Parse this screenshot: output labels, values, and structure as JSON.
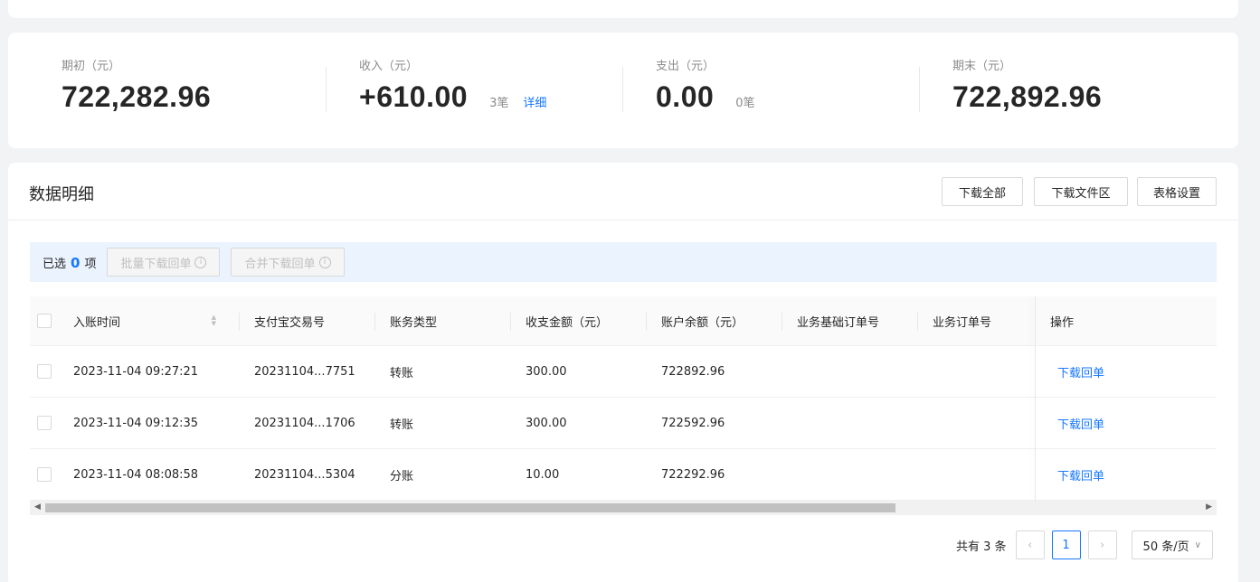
{
  "summary": {
    "opening": {
      "label": "期初（元）",
      "value": "722,282.96"
    },
    "income": {
      "label": "收入（元）",
      "value": "+610.00",
      "count": "3笔",
      "detail": "详细"
    },
    "expense": {
      "label": "支出（元）",
      "value": "0.00",
      "count": "0笔"
    },
    "closing": {
      "label": "期末（元）",
      "value": "722,892.96"
    }
  },
  "panel": {
    "title": "数据明细",
    "buttons": {
      "download_all": "下载全部",
      "download_files": "下载文件区",
      "table_settings": "表格设置"
    }
  },
  "selection": {
    "prefix": "已选",
    "count": "0",
    "suffix": "项",
    "batch_download": "批量下载回单",
    "merge_download": "合并下载回单"
  },
  "table": {
    "columns": {
      "time": "入账时间",
      "trade_no": "支付宝交易号",
      "type": "账务类型",
      "amount": "收支金额（元）",
      "balance": "账户余额（元）",
      "base_order": "业务基础订单号",
      "order": "业务订单号",
      "action": "操作"
    },
    "rows": [
      {
        "time": "2023-11-04 09:27:21",
        "trade_no": "20231104...7751",
        "type": "转账",
        "amount": "300.00",
        "balance": "722892.96",
        "base_order": "",
        "order": "",
        "action": "下载回单"
      },
      {
        "time": "2023-11-04 09:12:35",
        "trade_no": "20231104...1706",
        "type": "转账",
        "amount": "300.00",
        "balance": "722592.96",
        "base_order": "",
        "order": "",
        "action": "下载回单"
      },
      {
        "time": "2023-11-04 08:08:58",
        "trade_no": "20231104...5304",
        "type": "分账",
        "amount": "10.00",
        "balance": "722292.96",
        "base_order": "",
        "order": "",
        "action": "下载回单"
      }
    ]
  },
  "pagination": {
    "total": "共有 3 条",
    "current_page": "1",
    "page_size": "50 条/页"
  },
  "colors": {
    "accent": "#1677ff",
    "selection_bar": "#ebf3ff"
  }
}
